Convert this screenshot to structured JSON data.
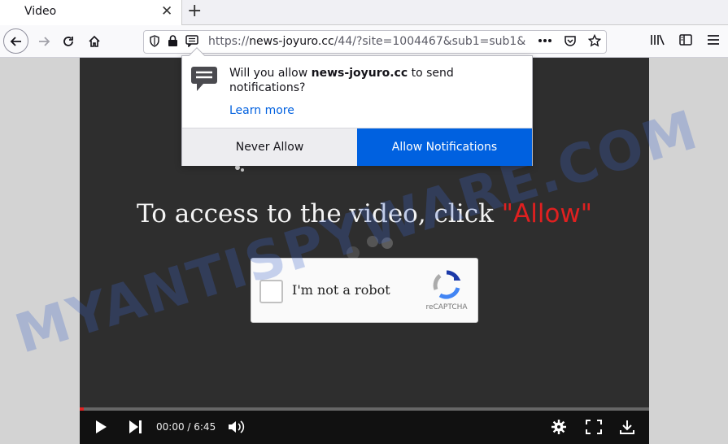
{
  "tab": {
    "title": "Video",
    "close_glyph": "✕",
    "new_tab_glyph": "+"
  },
  "address_bar": {
    "url_prefix": "https://",
    "url_domain": "news-joyuro.cc",
    "url_rest": "/44/?site=1004467&sub1=sub1&"
  },
  "popup": {
    "message_before": "Will you allow ",
    "message_domain": "news-joyuro.cc",
    "message_after": " to send notifications?",
    "learn_more": "Learn more",
    "never_allow": "Never Allow",
    "allow": "Allow Notifications"
  },
  "page": {
    "headline": "To access to the video, click ",
    "headline_allow": "\"Allow\"",
    "captcha_label": "I'm not a robot",
    "captcha_brand": "reCAPTCHA",
    "timecode": "00:00 / 6:45",
    "progress": 0.007,
    "watermark": "MYANTISPYWARE.COM"
  },
  "colors": {
    "accent": "#0061e0",
    "allow_text": "#e02020"
  }
}
